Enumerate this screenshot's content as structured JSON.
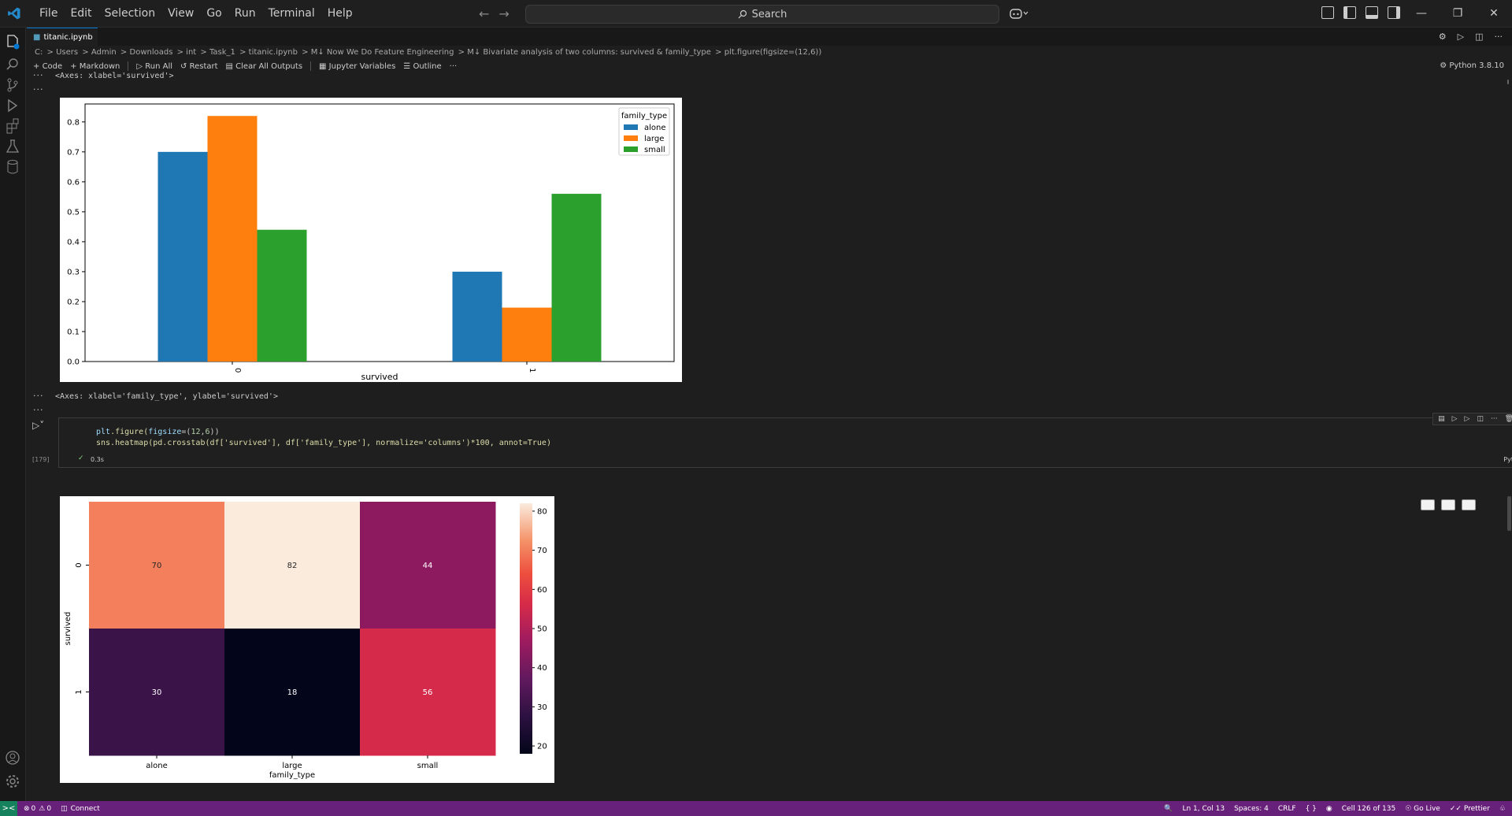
{
  "menu": [
    "File",
    "Edit",
    "Selection",
    "View",
    "Go",
    "Run",
    "Terminal",
    "Help"
  ],
  "search": {
    "label": "Search"
  },
  "tab": {
    "name": "titanic.ipynb"
  },
  "breadcrumbs": [
    "C:",
    "Users",
    "Admin",
    "Downloads",
    "int",
    "Task_1",
    "titanic.ipynb",
    "M↓ Now We Do Feature Engineering",
    "M↓ Bivariate analysis of two columns: survived & family_type",
    "plt.figure(figsize=(12,6))"
  ],
  "toolbar": {
    "code": "Code",
    "markdown": "Markdown",
    "run_all": "Run All",
    "restart": "Restart",
    "clear": "Clear All Outputs",
    "variables": "Jupyter Variables",
    "outline": "Outline",
    "more": "···",
    "kernel": "Python 3.8.10"
  },
  "output1": {
    "label": "<Axes: xlabel='survived'>"
  },
  "cell": {
    "line1_a": "plt",
    "line1_b": ".figure(",
    "line1_c": "figsize",
    "line1_d": "=(",
    "line1_e": "12",
    "line1_f": ",",
    "line1_g": "6",
    "line1_h": "))",
    "line2": "sns.heatmap(pd.crosstab(df['survived'], df['family_type'], normalize='columns')*100, annot=True)",
    "exec_count": "[179]",
    "time": "0.3s",
    "language": "Python"
  },
  "output2": {
    "label": "<Axes: xlabel='family_type', ylabel='survived'>"
  },
  "status": {
    "errors": "0",
    "warnings": "0",
    "connect": "Connect",
    "position": "Ln 1, Col 13",
    "spaces": "Spaces: 4",
    "eol": "CRLF",
    "cell_info": "Cell 126 of 135",
    "golive": "Go Live",
    "prettier": "Prettier"
  },
  "chart_data": [
    {
      "type": "bar",
      "categories": [
        "0",
        "1"
      ],
      "series": [
        {
          "name": "alone",
          "values": [
            0.7,
            0.3
          ],
          "color": "#1f77b4"
        },
        {
          "name": "large",
          "values": [
            0.82,
            0.18
          ],
          "color": "#ff7f0e"
        },
        {
          "name": "small",
          "values": [
            0.44,
            0.56
          ],
          "color": "#2ca02c"
        }
      ],
      "xlabel": "survived",
      "ylabel": "",
      "ylim": [
        0,
        0.86
      ],
      "yticks": [
        "0.0",
        "0.1",
        "0.2",
        "0.3",
        "0.4",
        "0.5",
        "0.6",
        "0.7",
        "0.8"
      ],
      "legend_title": "family_type",
      "legend_position": "top-right"
    },
    {
      "type": "heatmap",
      "x": [
        "alone",
        "large",
        "small"
      ],
      "y": [
        "0",
        "1"
      ],
      "values": [
        [
          70,
          82,
          44
        ],
        [
          30,
          18,
          56
        ]
      ],
      "xlabel": "family_type",
      "ylabel": "survived",
      "colorbar_ticks": [
        "20",
        "30",
        "40",
        "50",
        "60",
        "70",
        "80"
      ],
      "colorbar_range": [
        18,
        82
      ]
    }
  ]
}
